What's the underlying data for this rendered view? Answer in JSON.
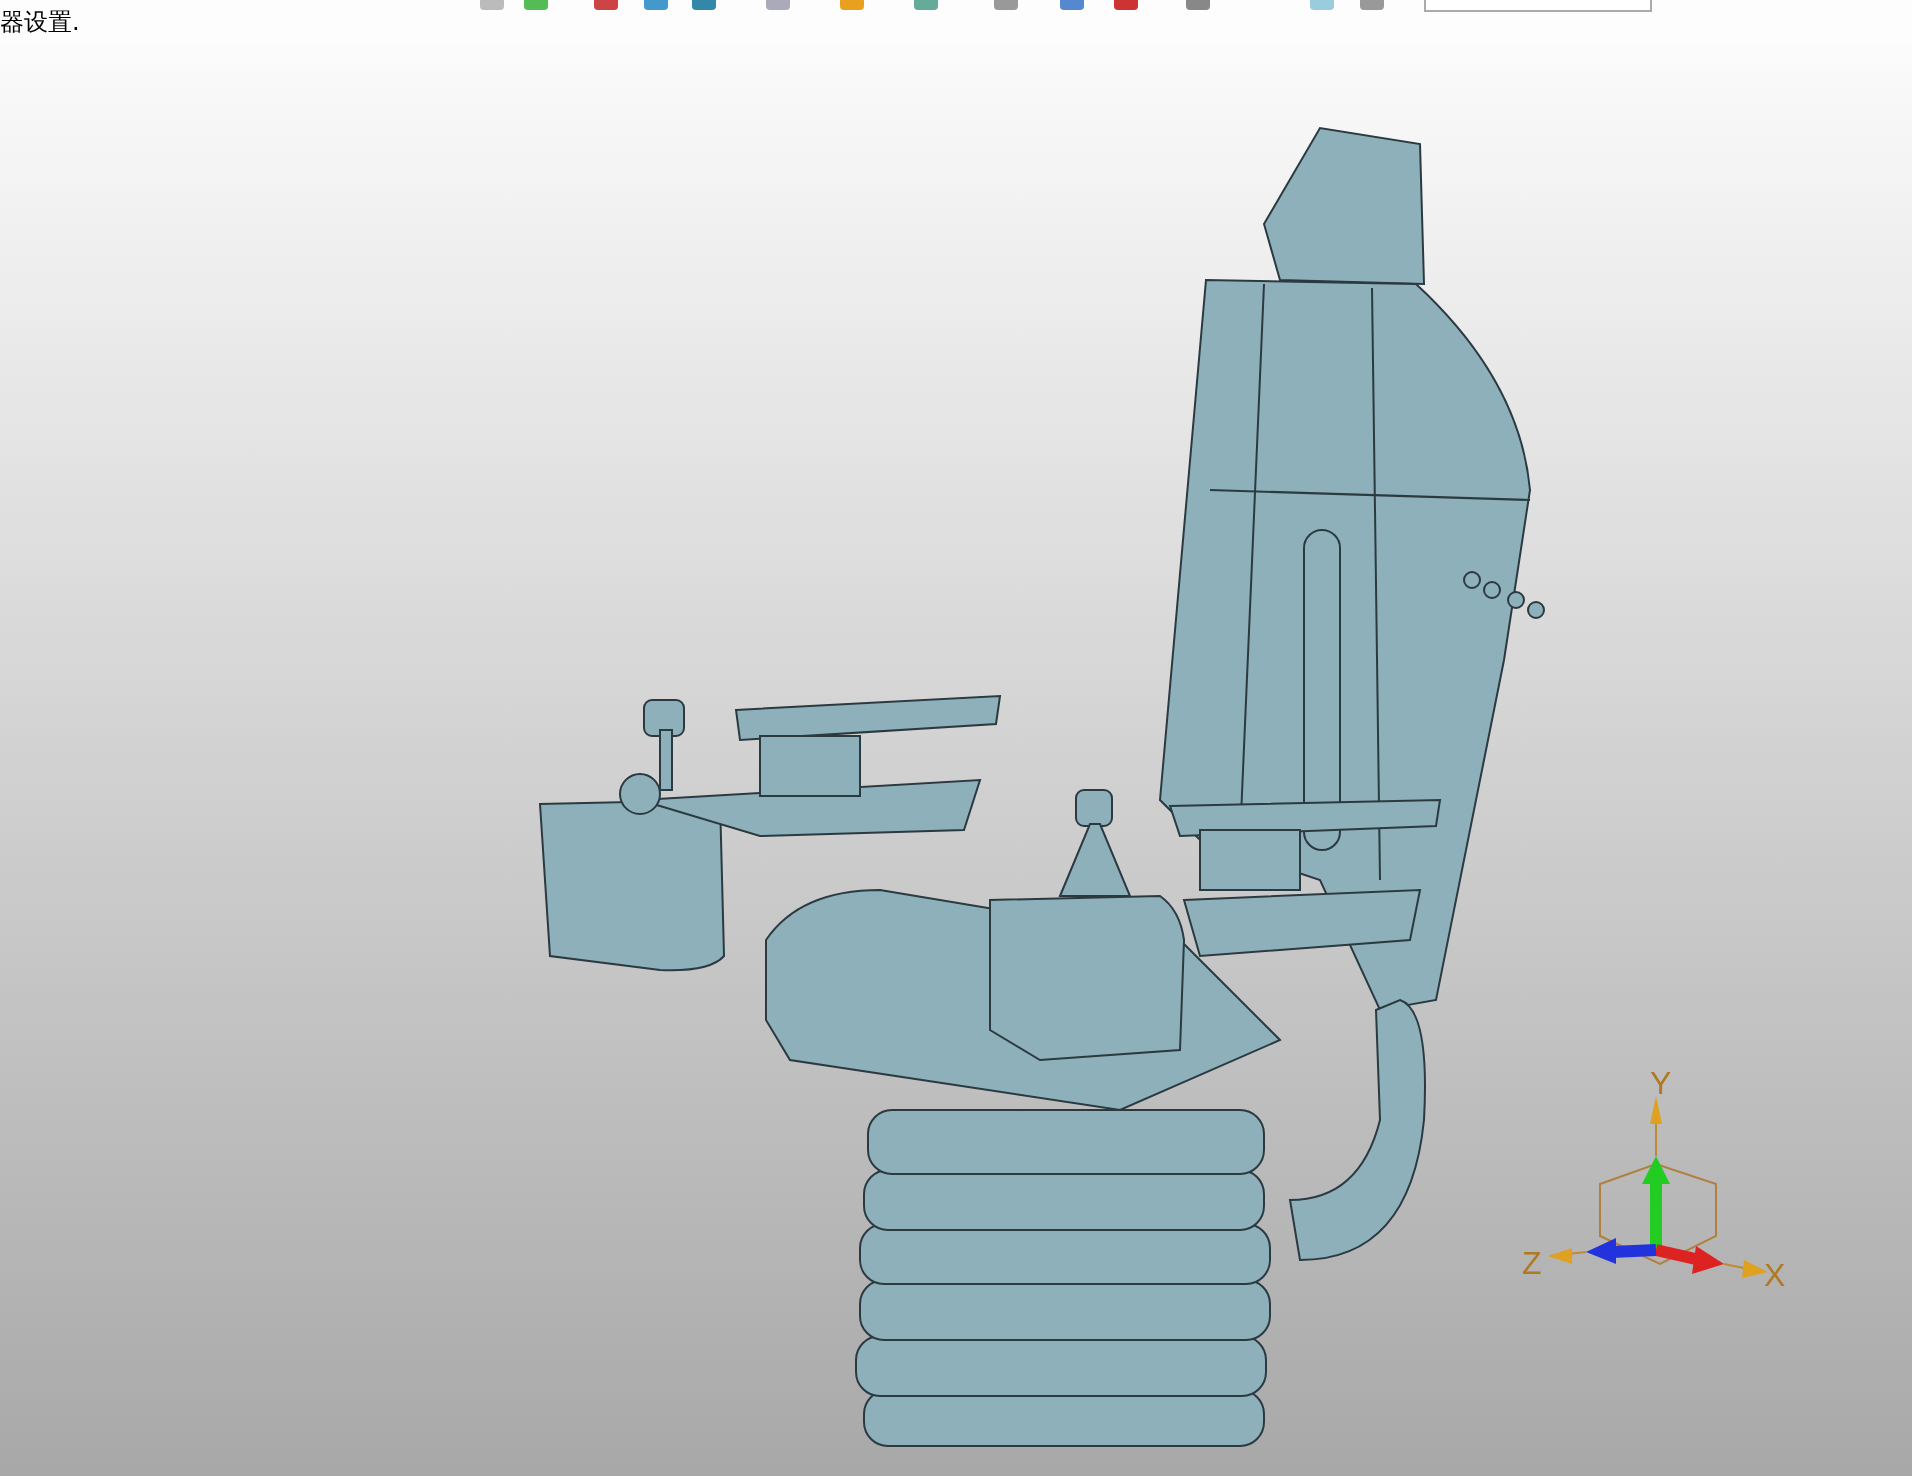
{
  "status_bar": {
    "text": "器设置."
  },
  "viewport": {
    "triad": {
      "axes": [
        {
          "label": "Y"
        },
        {
          "label": "Z"
        },
        {
          "label": "X"
        }
      ]
    }
  }
}
